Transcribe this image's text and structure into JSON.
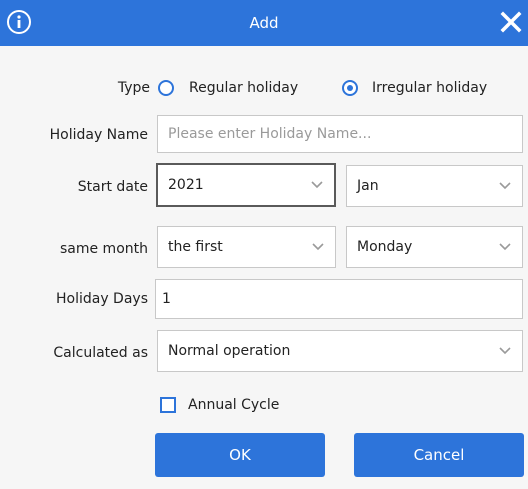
{
  "dialog": {
    "title": "Add",
    "info_icon": "info-icon",
    "close_icon": "close-icon",
    "accent_color": "#2d74da"
  },
  "form": {
    "type": {
      "label": "Type",
      "options": [
        {
          "label": "Regular holiday",
          "selected": false
        },
        {
          "label": "Irregular holiday",
          "selected": true
        }
      ]
    },
    "holiday_name": {
      "label": "Holiday Name",
      "value": "",
      "placeholder": "Please enter Holiday Name..."
    },
    "start_date": {
      "label": "Start date",
      "year": "2021",
      "month": "Jan"
    },
    "same_month": {
      "label": "same month",
      "ordinal": "the first",
      "weekday": "Monday"
    },
    "holiday_days": {
      "label": "Holiday Days",
      "value": "1"
    },
    "calculated_as": {
      "label": "Calculated as",
      "value": "Normal operation"
    },
    "annual_cycle": {
      "label": "Annual Cycle",
      "checked": false
    }
  },
  "buttons": {
    "ok": "OK",
    "cancel": "Cancel"
  }
}
